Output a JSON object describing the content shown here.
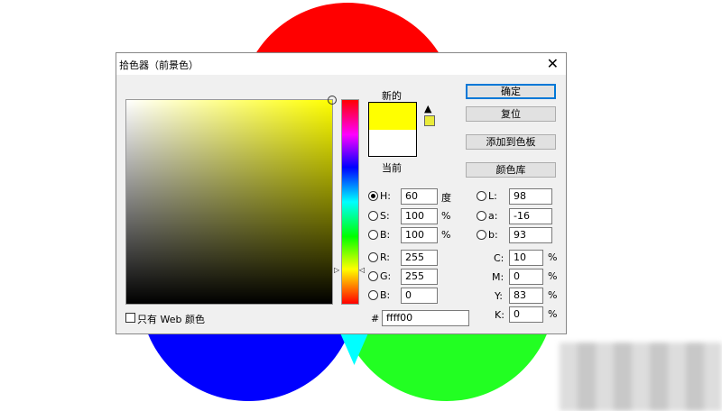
{
  "dialog": {
    "title": "拾色器（前景色）",
    "close": "✕",
    "new_label": "新的",
    "current_label": "当前",
    "buttons": {
      "ok": "确定",
      "reset": "复位",
      "add_swatch": "添加到色板",
      "libraries": "颜色库"
    },
    "web_only_label": "只有 Web 颜色",
    "hsb": [
      {
        "label": "H:",
        "value": "60",
        "unit": "度",
        "selected": true
      },
      {
        "label": "S:",
        "value": "100",
        "unit": "%"
      },
      {
        "label": "B:",
        "value": "100",
        "unit": "%"
      }
    ],
    "rgb": [
      {
        "label": "R:",
        "value": "255"
      },
      {
        "label": "G:",
        "value": "255"
      },
      {
        "label": "B:",
        "value": "0"
      }
    ],
    "lab": [
      {
        "label": "L:",
        "value": "98"
      },
      {
        "label": "a:",
        "value": "-16"
      },
      {
        "label": "b:",
        "value": "93"
      }
    ],
    "cmyk": [
      {
        "label": "C:",
        "value": "10",
        "unit": "%"
      },
      {
        "label": "M:",
        "value": "0",
        "unit": "%"
      },
      {
        "label": "Y:",
        "value": "83",
        "unit": "%"
      },
      {
        "label": "K:",
        "value": "0",
        "unit": "%"
      }
    ],
    "hex_label": "#",
    "hex": "ffff00",
    "new_color": "#ffff00",
    "current_color": "#ffffff",
    "warning_color": "#eaeb3a"
  }
}
